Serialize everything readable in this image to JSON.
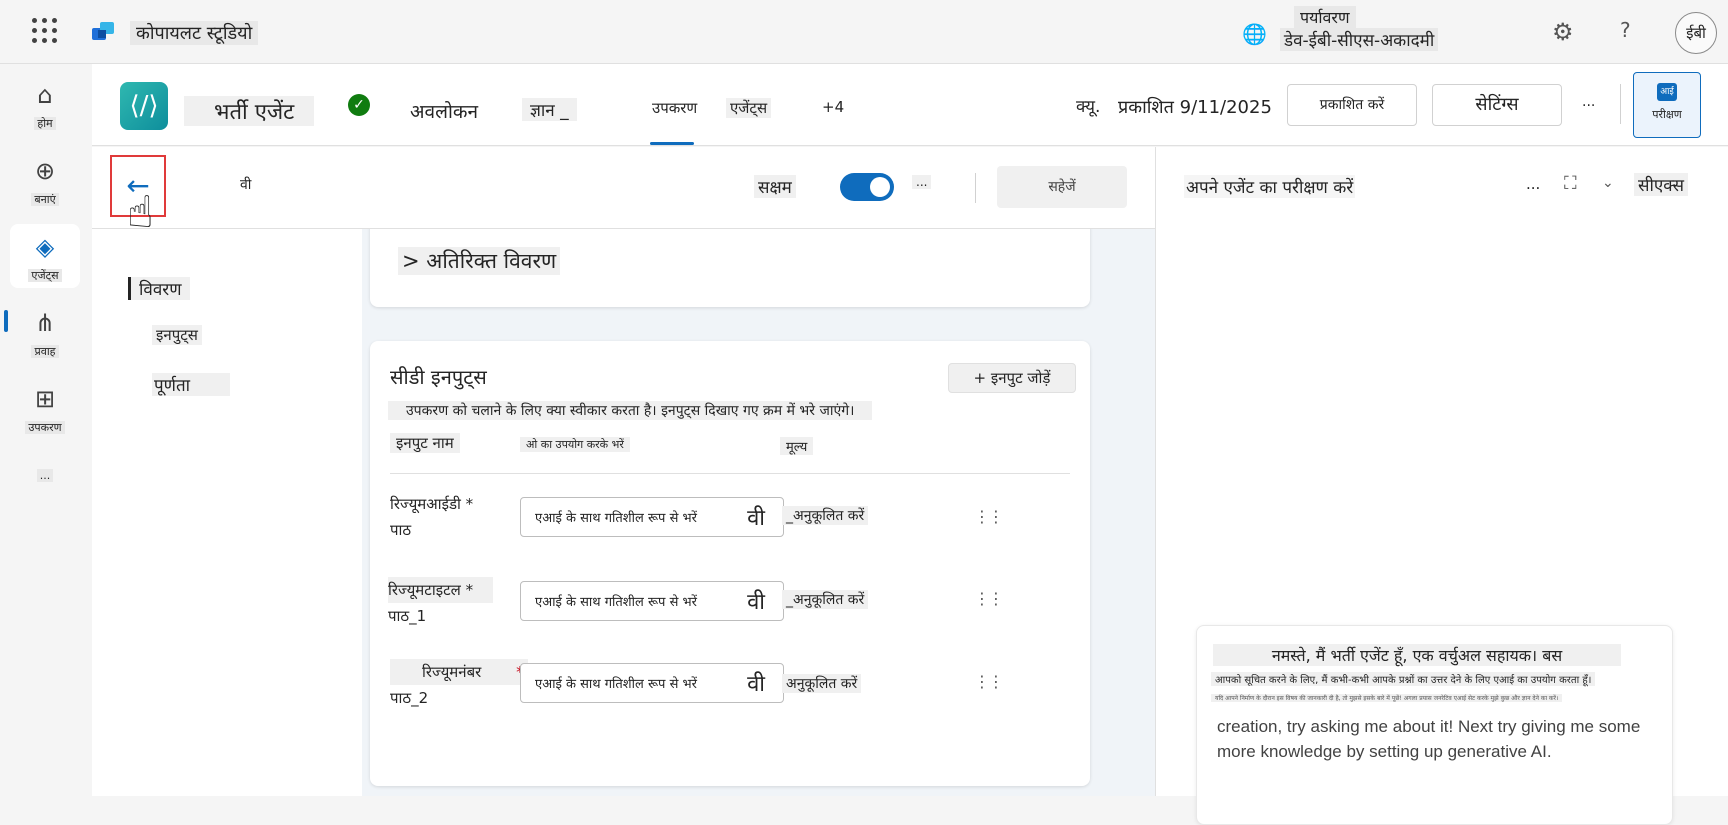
{
  "topbar": {
    "app_name": "कोपायलट स्टूडियो",
    "env_label": "पर्यावरण",
    "env_name": "डेव-ईबी-सीएस-अकादमी",
    "avatar_initials": "ईबी"
  },
  "leftnav": {
    "items": [
      {
        "label": "होम",
        "icon": "home-icon"
      },
      {
        "label": "बनाएं",
        "icon": "plus-circle-icon"
      },
      {
        "label": "एजेंट्स",
        "icon": "agents-icon"
      },
      {
        "label": "प्रवाह",
        "icon": "flow-icon"
      },
      {
        "label": "उपकरण",
        "icon": "tools-icon"
      },
      {
        "label": "...",
        "icon": "more-icon"
      }
    ],
    "active_index": 2
  },
  "agentbar": {
    "agent_name": "भर्ती एजेंट",
    "tabs": [
      {
        "label": "अवलोकन"
      },
      {
        "label": "ज्ञान _"
      },
      {
        "label": "उपकरण"
      },
      {
        "label": "एजेंट्स"
      },
      {
        "label": "+4"
      }
    ],
    "active_tab": 2,
    "publish_icon_text": "क्यू.",
    "published_text": "प्रकाशित 9/11/2025",
    "publish_button": "प्रकाशित करें",
    "settings_button": "सेटिंग्स",
    "more": "...",
    "test_icon_text": "आई",
    "test_button": "परीक्षण"
  },
  "toolbar": {
    "tool_abbrev": "वी",
    "enabled_label": "सक्षम",
    "enabled": true,
    "more": "...",
    "save_button": "सहेजें"
  },
  "sidenav": {
    "items": [
      "विवरण",
      "इनपुट्स",
      "पूर्णता"
    ],
    "active_index": 0
  },
  "details_card": {
    "title": "> अतिरिक्त विवरण"
  },
  "inputs_card": {
    "title": "सीडी इनपुट्स",
    "add_button": "+ इनपुट जोड़ें",
    "description": "उपकरण को चलाने के लिए क्या स्वीकार करता है। इनपुट्स दिखाए गए क्रम में भरे जाएंगे।",
    "headers": [
      "इनपुट नाम",
      "ओ का उपयोग करके भरें",
      "मूल्य"
    ],
    "rows": [
      {
        "name": "रिज्यूमआईडी *",
        "type": "पाठ",
        "fill": "एआई के साथ गतिशील रूप से भरें",
        "fill_suffix": "वी",
        "value": "_अनुकूलित करें"
      },
      {
        "name": "रिज्यूमटाइटल *",
        "type": "पाठ_1",
        "fill": "एआई के साथ गतिशील रूप से भरें",
        "fill_suffix": "वी",
        "value": "_अनुकूलित करें"
      },
      {
        "name": "रिज्यूमनंबर",
        "required_mark": "*",
        "type": "पाठ_2",
        "fill": "एआई के साथ गतिशील रूप से भरें",
        "fill_suffix": "वी",
        "value": "अनुकूलित करें"
      }
    ]
  },
  "testpanel": {
    "title": "अपने एजेंट का परीक्षण करें",
    "more": "...",
    "cx_label": "सीएक्स",
    "message_line1": "नमस्ते, मैं भर्ती एजेंट हूँ, एक वर्चुअल सहायक। बस",
    "message_line2": "आपको सूचित करने के लिए, मैं कभी-कभी आपके प्रश्नों का उत्तर देने के लिए एआई का उपयोग करता हूँ।",
    "message_line3": "यदि आपने निर्माण के दौरान इस विषय की जानकारी दी है, तो मुझसे इसके बारे में पूछें! अगला प्रयास जनरेटिव एआई सेट करके मुझे कुछ और ज्ञान देने का करें।",
    "message_line4": "creation, try asking me about it! Next try giving me some more knowledge by setting up generative AI."
  },
  "colors": {
    "accent": "#0f6cbd",
    "verified": "#107c10",
    "highlight_border": "#e03a3a"
  }
}
